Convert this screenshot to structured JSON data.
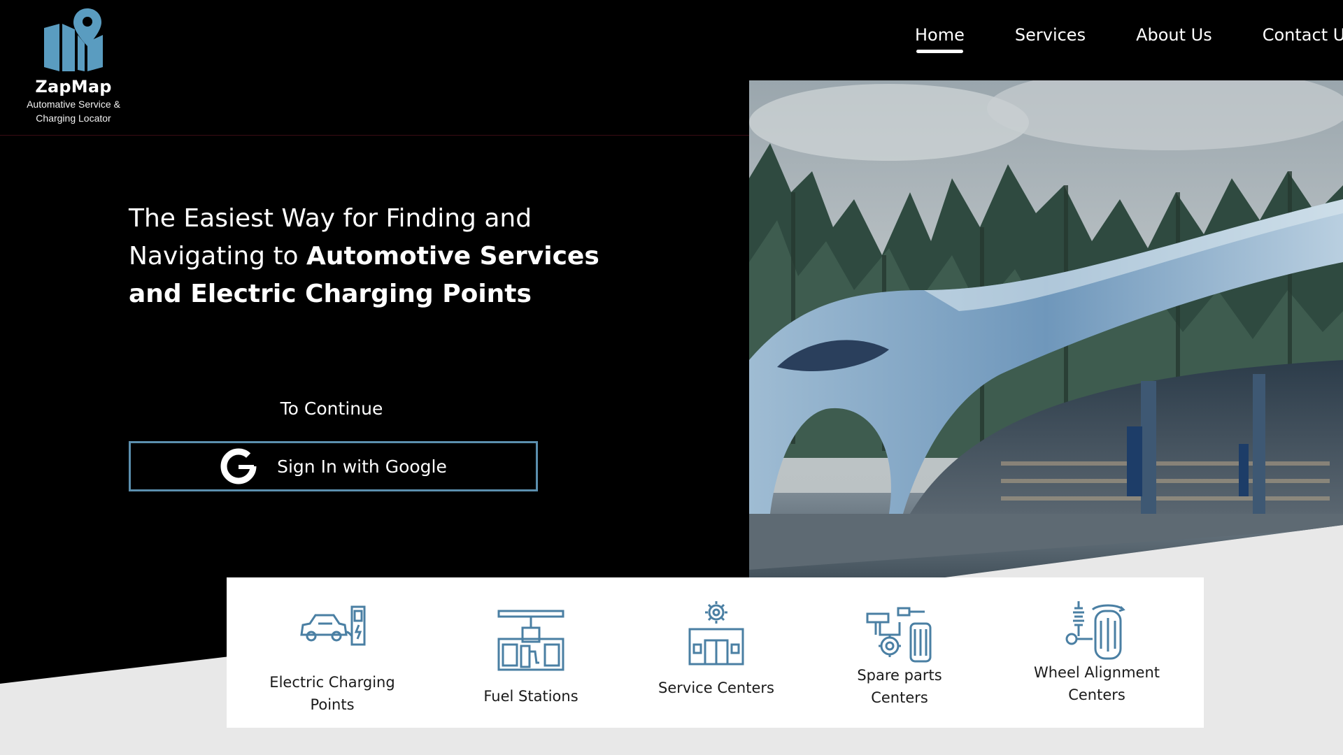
{
  "brand": {
    "name": "ZapMap",
    "tagline_line1": "Automative Service &",
    "tagline_line2": "Charging Locator",
    "logo_icon": "map-pin-icon"
  },
  "nav": {
    "items": [
      {
        "label": "Home",
        "active": true
      },
      {
        "label": "Services",
        "active": false
      },
      {
        "label": "About Us",
        "active": false
      },
      {
        "label": "Contact Us",
        "active": false
      }
    ]
  },
  "hero": {
    "headline_part1": "The Easiest Way for Finding and",
    "headline_part2": "Navigating to ",
    "headline_bold1": "Automotive Services",
    "headline_bold2": "and Electric Charging Points",
    "continue_label": "To Continue",
    "signin_label": "Sign In with Google",
    "signin_icon": "google-icon"
  },
  "services": [
    {
      "label_line1": "Electric Charging",
      "label_line2": "Points",
      "icon": "ev-charging-icon"
    },
    {
      "label_line1": "Fuel Stations",
      "label_line2": "",
      "icon": "fuel-station-icon"
    },
    {
      "label_line1": "Service Centers",
      "label_line2": "",
      "icon": "service-center-icon"
    },
    {
      "label_line1": "Spare parts",
      "label_line2": "Centers",
      "icon": "spare-parts-icon"
    },
    {
      "label_line1": "Wheel Alignment",
      "label_line2": "Centers",
      "icon": "wheel-alignment-icon"
    }
  ],
  "colors": {
    "accent": "#5b8fae",
    "logo_blue": "#5a9cc0",
    "background": "#000000",
    "band": "#e8e8e8"
  }
}
